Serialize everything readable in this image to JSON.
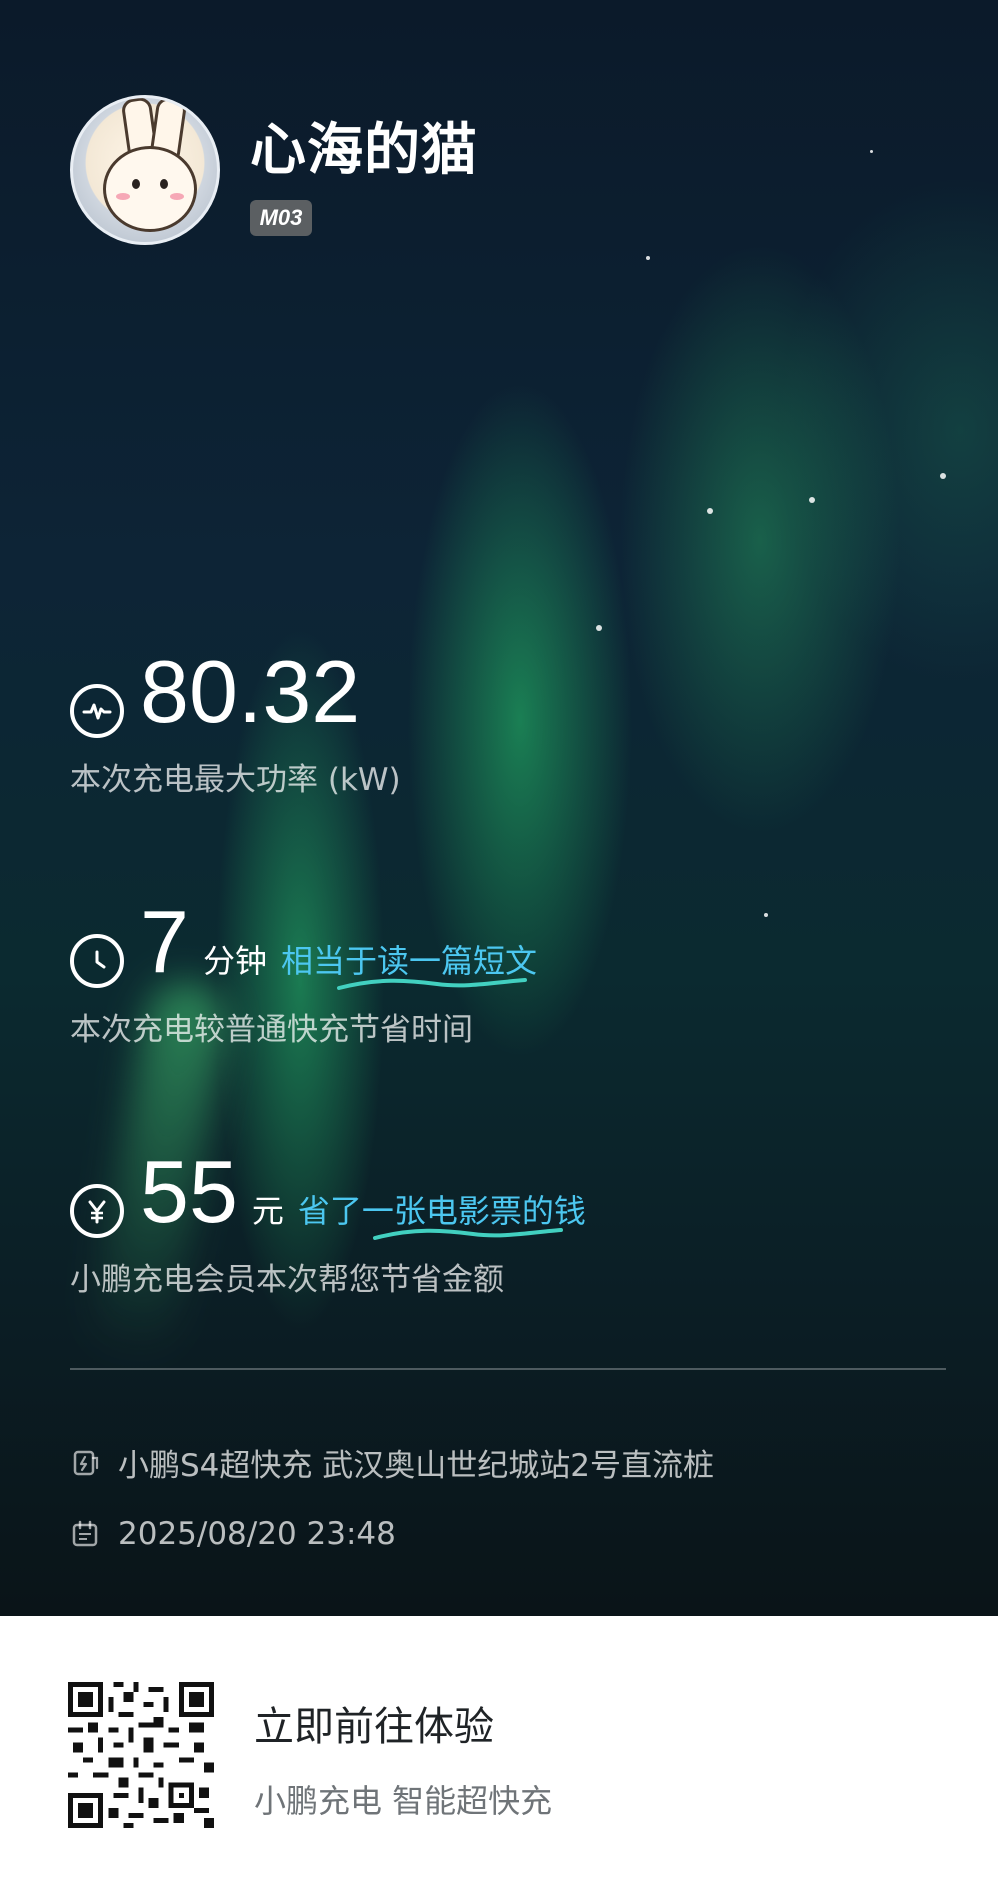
{
  "profile": {
    "username": "心海的猫",
    "model_badge": "M03",
    "avatar_icon": "bunny-avatar"
  },
  "stats": [
    {
      "icon": "pulse-icon",
      "value": "80.32",
      "unit": "",
      "highlight": "",
      "description": "本次充电最大功率 (kW)"
    },
    {
      "icon": "clock-icon",
      "value": "7",
      "unit": "分钟",
      "highlight": "相当于读一篇短文",
      "description": "本次充电较普通快充节省时间"
    },
    {
      "icon": "yen-icon",
      "value": "55",
      "unit": "元",
      "highlight": "省了一张电影票的钱",
      "description": "小鹏充电会员本次帮您节省金额"
    }
  ],
  "info": {
    "station": "小鹏S4超快充 武汉奥山世纪城站2号直流桩",
    "station_icon": "charging-station-icon",
    "datetime": "2025/08/20 23:48",
    "datetime_icon": "calendar-icon"
  },
  "footer": {
    "cta_title": "立即前往体验",
    "cta_subtitle": "小鹏充电 智能超快充",
    "qr_icon": "qr-code"
  },
  "colors": {
    "highlight": "#4cc7f0",
    "background_top": "#0b1a2a",
    "aurora": "#2ec878"
  }
}
